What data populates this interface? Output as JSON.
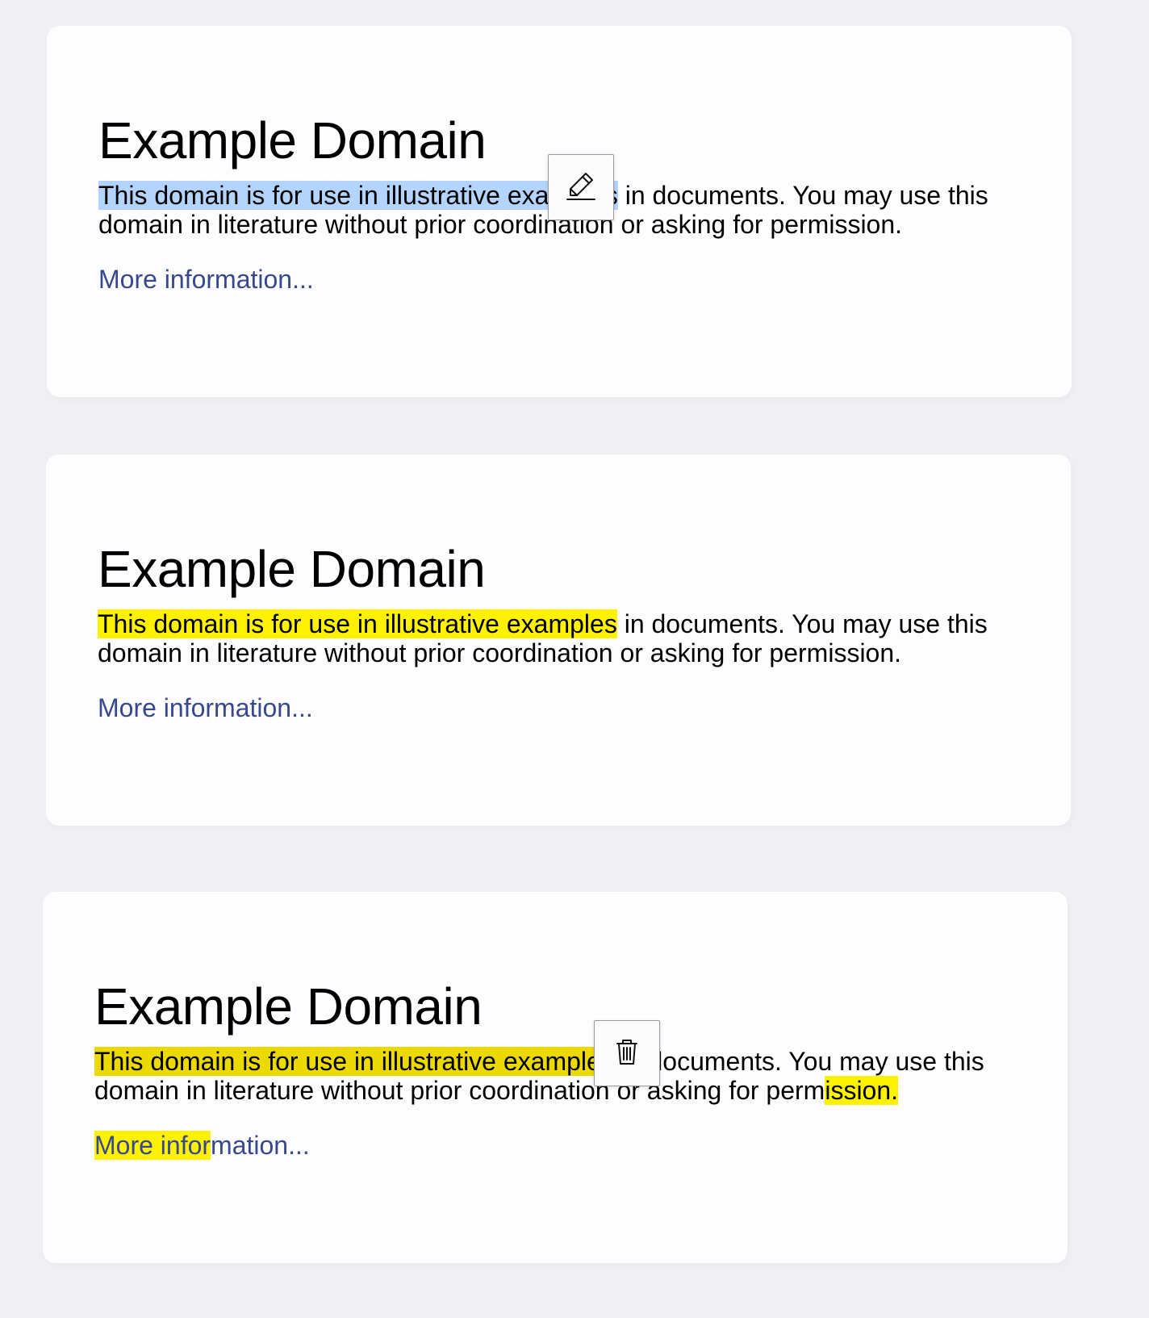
{
  "cards": [
    {
      "title": "Example Domain",
      "highlighted_text": "This domain is for use in illustrative examples",
      "rest_line1": " in documents. You may use this",
      "line2": "domain in literature without prior coordination or asking for permission.",
      "link": "More information..."
    },
    {
      "title": "Example Domain",
      "highlighted_text": "This domain is for use in illustrative examples",
      "rest_line1": " in documents. You may use this",
      "line2": "domain in literature without prior coordination or asking for permission.",
      "link": "More information..."
    },
    {
      "title": "Example Domain",
      "highlighted_text": "This domain is for use in illustrative examples",
      "rest_line1": " in documents. You may use this",
      "line2_plain": "domain in literature without prior coordination or asking for perm",
      "line2_highlighted": "ission.",
      "link_highlighted": "More infor",
      "link_plain": "mation..."
    }
  ],
  "toolbar": {
    "highlight_icon": "highlighter-pen-icon",
    "delete_icon": "trash-icon"
  },
  "colors": {
    "selection": "#b3d4fc",
    "highlight": "#fff200",
    "highlight_active": "#ebd900",
    "link": "#38488f",
    "page_bg": "#f0f0f2"
  }
}
